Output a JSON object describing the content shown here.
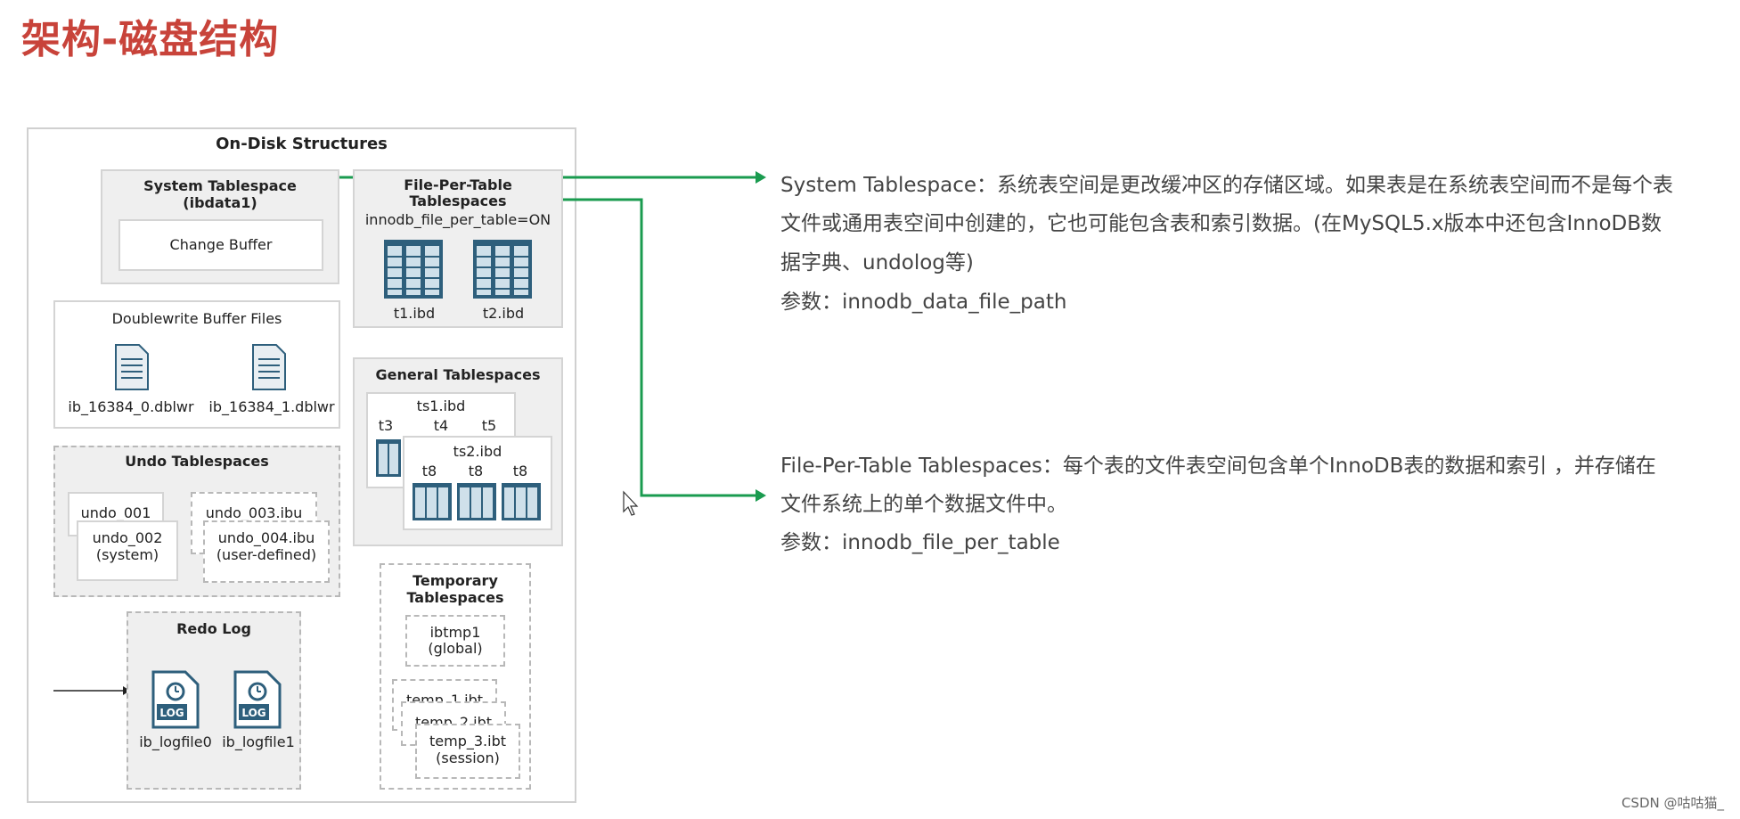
{
  "title": "架构-磁盘结构",
  "diagram": {
    "heading": "On-Disk Structures",
    "system_tablespace": {
      "title_line1": "System Tablespace",
      "title_line2": "(ibdata1)",
      "change_buffer": "Change Buffer"
    },
    "file_per_table": {
      "title_line1": "File-Per-Table",
      "title_line2": "Tablespaces",
      "setting": "innodb_file_per_table=ON",
      "files": [
        "t1.ibd",
        "t2.ibd"
      ]
    },
    "doublewrite": {
      "title": "Doublewrite Buffer Files",
      "files": [
        "ib_16384_0.dblwr",
        "ib_16384_1.dblwr"
      ]
    },
    "general": {
      "title": "General Tablespaces",
      "ts1": "ts1.ibd",
      "ts1_tables": [
        "t3",
        "t4",
        "t5"
      ],
      "ts2": "ts2.ibd",
      "ts2_tables": [
        "t8",
        "t8",
        "t8"
      ]
    },
    "undo": {
      "title": "Undo Tablespaces",
      "u1": "undo_001",
      "u2": "undo_002",
      "u2_sub": "(system)",
      "u3": "undo_003.ibu",
      "u4": "undo_004.ibu",
      "u4_sub": "(user-defined)"
    },
    "temporary": {
      "title_line1": "Temporary",
      "title_line2": "Tablespaces",
      "ibtmp": "ibtmp1",
      "ibtmp_sub": "(global)",
      "t1": "temp_1.ibt",
      "t2": "temp_2.ibt",
      "t3": "temp_3.ibt",
      "t3_sub": "(session)"
    },
    "redo": {
      "title": "Redo Log",
      "files": [
        "ib_logfile0",
        "ib_logfile1"
      ],
      "icon_text": "LOG"
    }
  },
  "descriptions": {
    "system": {
      "lines": [
        "System Tablespace：系统表空间是更改缓冲区的存储区域。如果表是在系统表空间而不是每个表",
        "文件或通用表空间中创建的，它也可能包含表和索引数据。(在MySQL5.x版本中还包含InnoDB数",
        "据字典、undolog等)"
      ],
      "param": "参数：innodb_data_file_path"
    },
    "file_per_table": {
      "lines": [
        "File-Per-Table Tablespaces：每个表的文件表空间包含单个InnoDB表的数据和索引 ，并存储在",
        "文件系统上的单个数据文件中。"
      ],
      "param": "参数：innodb_file_per_table"
    }
  },
  "watermark": "CSDN @咕咕猫_",
  "colors": {
    "title": "#c8433a",
    "arrow": "#1a9b4f",
    "table_icon": "#2e5f7c"
  }
}
